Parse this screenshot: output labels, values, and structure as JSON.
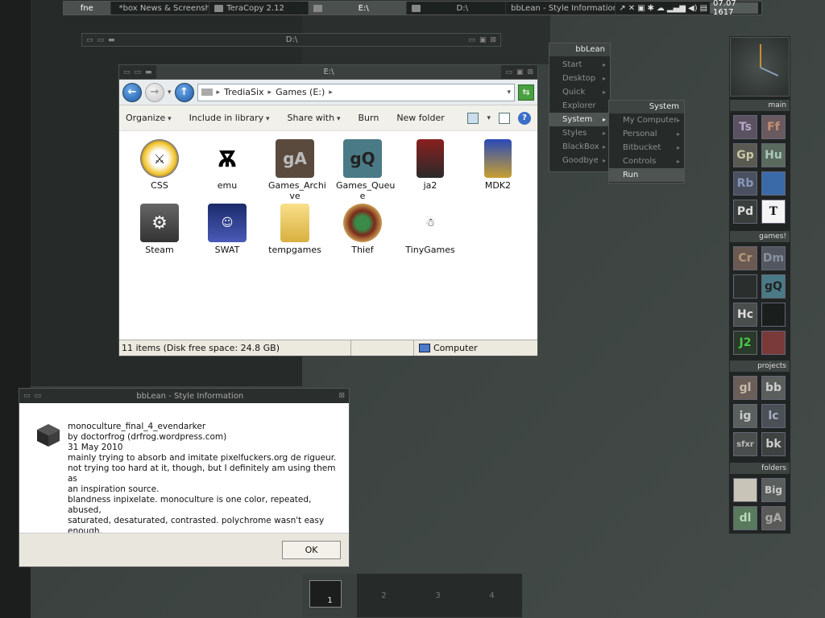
{
  "taskbar": {
    "items": [
      {
        "label": "fne",
        "active": true
      },
      {
        "label": "*box News & Screensh...",
        "active": false
      },
      {
        "label": "TeraCopy 2.12",
        "active": false
      },
      {
        "label": "E:\\",
        "active": true
      },
      {
        "label": "D:\\",
        "active": false
      },
      {
        "label": "bbLean - Style Information",
        "active": false
      }
    ],
    "clock": "07.07 1617"
  },
  "shade_window": {
    "title": "D:\\"
  },
  "explorer": {
    "title": "E:\\",
    "breadcrumb": [
      "TrediaSix",
      "Games (E:)"
    ],
    "toolbar": {
      "organize": "Organize",
      "include": "Include in library",
      "share": "Share with",
      "burn": "Burn",
      "new_folder": "New folder"
    },
    "files": [
      {
        "name": "CSS"
      },
      {
        "name": "emu"
      },
      {
        "name": "Games_Archi ve",
        "badge": "gA"
      },
      {
        "name": "Games_Queu e",
        "badge": "gQ"
      },
      {
        "name": "ja2"
      },
      {
        "name": "MDK2"
      },
      {
        "name": "Steam"
      },
      {
        "name": "SWAT"
      },
      {
        "name": "tempgames"
      },
      {
        "name": "Thief"
      },
      {
        "name": "TinyGames"
      }
    ],
    "status": {
      "items": "11 items (Disk free space: 24.8 GB)",
      "location": "Computer"
    }
  },
  "menu": {
    "title": "bbLean",
    "items": [
      "Start",
      "Desktop",
      "Quick",
      "Explorer",
      "System",
      "Styles",
      "BlackBox",
      "Goodbye"
    ],
    "submenu_title": "System",
    "submenu_items": [
      "My Computer",
      "Personal",
      "Bitbucket",
      "Controls",
      "Run"
    ]
  },
  "slit": {
    "groups": [
      {
        "title": "main",
        "icons": [
          "Ts",
          "Ff",
          "Gp",
          "Hu",
          "Rb",
          "",
          "Pd",
          "T"
        ]
      },
      {
        "title": "games!",
        "icons": [
          "Cr",
          "Dm",
          "",
          "gQ",
          "Hc",
          "",
          "J2",
          ""
        ]
      },
      {
        "title": "projects",
        "icons": [
          "gl",
          "bb",
          "ig",
          "lc",
          "sfxr",
          "bk"
        ]
      },
      {
        "title": "folders",
        "icons": [
          "",
          "Big",
          "dl",
          "gA"
        ]
      }
    ]
  },
  "dialog": {
    "title": "bbLean - Style Information",
    "lines": [
      "monoculture_final_4_evendarker",
      "by doctorfrog (drfrog.wordpress.com)",
      "31 May 2010",
      "mainly trying to absorb and imitate pixelfuckers.org de rigueur.",
      "not trying too hard at it, though, but I definitely am using them as",
      "an inspiration source.",
      "blandness inpixelate. monoculture is one color, repeated, abused,",
      "saturated, desaturated, contrasted. polychrome wasn't easy",
      "enough."
    ],
    "ok_label": "OK"
  },
  "pager": {
    "workspaces": [
      "1",
      "2",
      "3",
      "4"
    ]
  }
}
